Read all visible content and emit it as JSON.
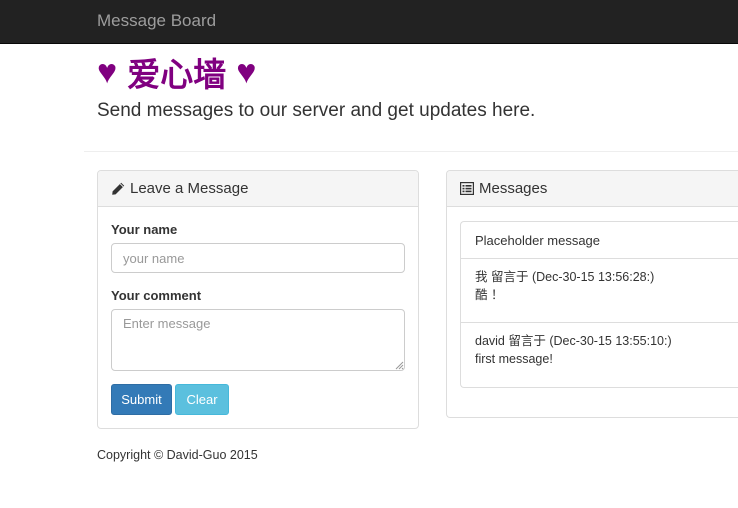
{
  "navbar": {
    "brand": "Message Board"
  },
  "header": {
    "heart_left": "♥",
    "title": "爱心墙",
    "heart_right": "♥",
    "lead": "Send messages to our server and get updates here."
  },
  "form_panel": {
    "heading_icon": "pencil-icon",
    "heading": "Leave a Message",
    "name_label": "Your name",
    "name_placeholder": "your name",
    "name_value": "",
    "comment_label": "Your comment",
    "comment_placeholder": "Enter message",
    "comment_value": "",
    "submit_label": "Submit",
    "clear_label": "Clear"
  },
  "messages_panel": {
    "heading_icon": "list-alt-icon",
    "heading": "Messages",
    "placeholder": "Placeholder message",
    "items": [
      {
        "meta": "我 留言于 (Dec-30-15 13:56:28:)",
        "text": "酷 ！"
      },
      {
        "meta": "david 留言于 (Dec-30-15 13:55:10:)",
        "text": "first message!"
      }
    ]
  },
  "footer": {
    "copyright": "Copyright © David-Guo 2015"
  },
  "colors": {
    "navbar_bg": "#222222",
    "title": "#800080",
    "primary": "#337ab7",
    "info": "#5bc0de"
  }
}
